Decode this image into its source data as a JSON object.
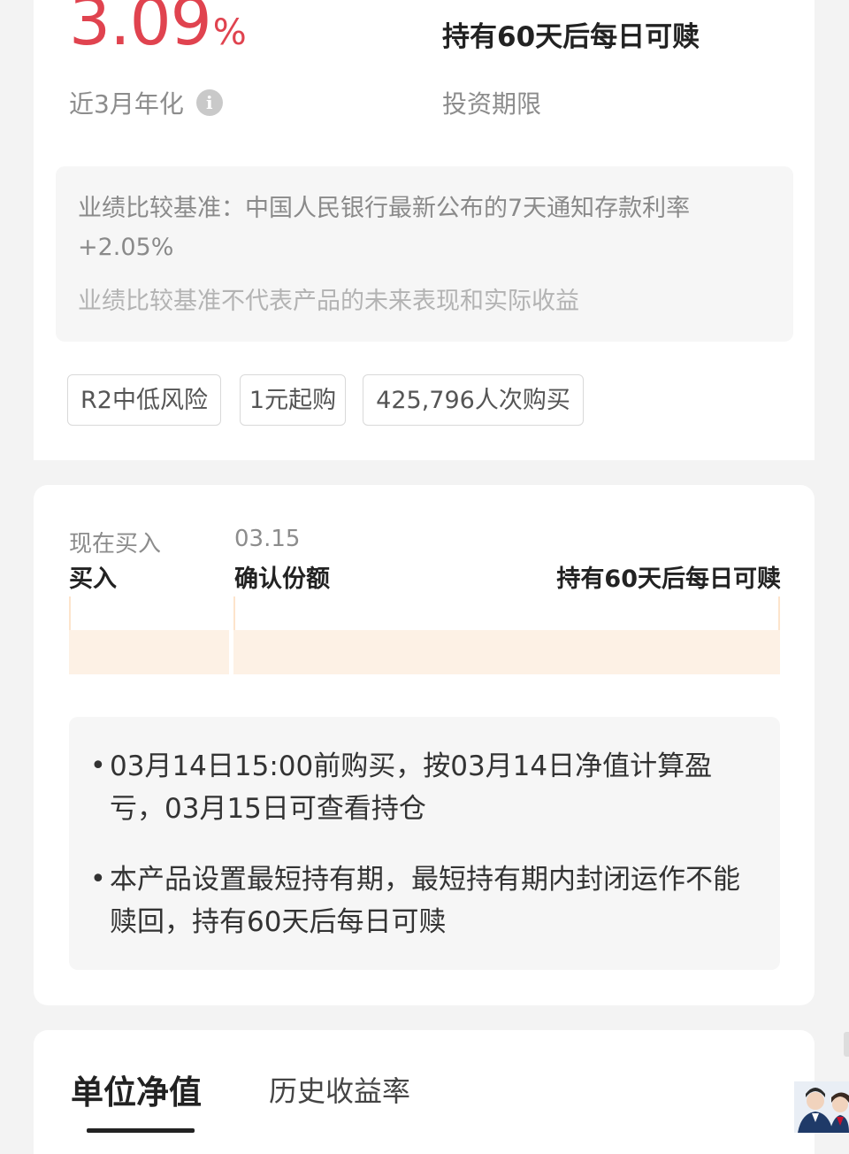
{
  "summary": {
    "rate_value": "3.09",
    "rate_unit": "%",
    "rate_label": "近3月年化",
    "info_icon": "i",
    "period_value": "持有60天后每日可赎",
    "period_label": "投资期限"
  },
  "benchmark": {
    "text": "业绩比较基准：中国人民银行最新公布的7天通知存款利率+2.05%",
    "note": "业绩比较基准不代表产品的未来表现和实际收益"
  },
  "tags": [
    "R2中低风险",
    "1元起购",
    "425,796人次购买"
  ],
  "timeline": {
    "step1_top": "现在买入",
    "step1_bottom": "买入",
    "step2_top": "03.15",
    "step2_bottom": "确认份额",
    "step3_bottom": "持有60天后每日可赎"
  },
  "rules": [
    "03月14日15:00前购买，按03月14日净值计算盈亏，03月15日可查看持仓",
    "本产品设置最短持有期，最短持有期内封闭运作不能赎回，持有60天后每日可赎"
  ],
  "bullet": "•",
  "tabs": {
    "active": "单位净值",
    "other": "历史收益率"
  },
  "colors": {
    "accent_red": "#e0434f",
    "timeline_bar": "#fdf1e5"
  }
}
